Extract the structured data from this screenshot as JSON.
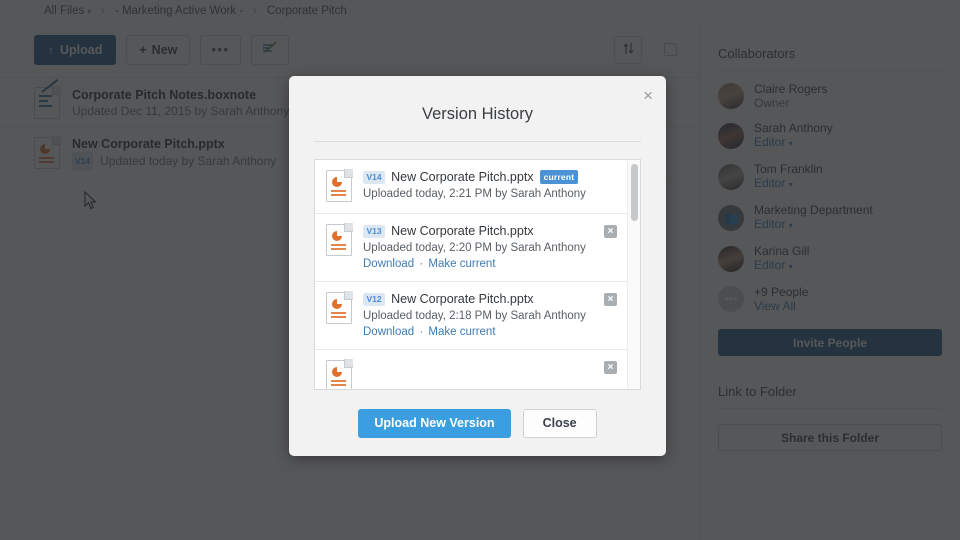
{
  "breadcrumb": {
    "items": [
      {
        "label": "All Files",
        "caret": true
      },
      {
        "label": "- Marketing Active Work -",
        "caret": false
      },
      {
        "label": "Corporate Pitch",
        "caret": false
      }
    ],
    "separator": "›",
    "caret_glyph": "▾"
  },
  "toolbar": {
    "upload_label": "Upload",
    "upload_icon": "↑",
    "new_label": "New",
    "new_icon": "+",
    "more_icon": "•••",
    "compose_icon": "compose-icon",
    "sort_icon": "↑↓",
    "select_all_icon": "checkbox-icon"
  },
  "files": [
    {
      "icon": "boxnote-icon",
      "name": "Corporate Pitch Notes.boxnote",
      "subtitle": "Updated Dec 11, 2015 by Sarah Anthony",
      "version_badge": ""
    },
    {
      "icon": "powerpoint-icon",
      "name": "New Corporate Pitch.pptx",
      "subtitle": "Updated today by Sarah Anthony",
      "version_badge": "V14"
    }
  ],
  "sidebar": {
    "collaborators_title": "Collaborators",
    "collaborators": [
      {
        "name": "Claire Rogers",
        "role": "Owner",
        "role_is_link": false,
        "avatar": "photo-avatar"
      },
      {
        "name": "Sarah Anthony",
        "role": "Editor",
        "role_is_link": true,
        "avatar": "photo-avatar"
      },
      {
        "name": "Tom Franklin",
        "role": "Editor",
        "role_is_link": true,
        "avatar": "photo-avatar"
      },
      {
        "name": "Marketing Department",
        "role": "Editor",
        "role_is_link": true,
        "avatar": "group-avatar"
      },
      {
        "name": "Karina Gill",
        "role": "Editor",
        "role_is_link": true,
        "avatar": "photo-avatar"
      },
      {
        "name": "+9 People",
        "role": "View All",
        "role_is_link": true,
        "avatar": "more-avatar"
      }
    ],
    "role_caret": "▾",
    "invite_label": "Invite People",
    "link_title": "Link to Folder",
    "share_label": "Share this Folder"
  },
  "modal": {
    "title": "Version History",
    "close_icon": "×",
    "versions": [
      {
        "badge": "V14",
        "name": "New Corporate Pitch.pptx",
        "current_label": "current",
        "is_current": true,
        "meta": "Uploaded today, 2:21 PM by Sarah Anthony",
        "download_label": "",
        "make_current_label": "",
        "separator": "",
        "deletable": false
      },
      {
        "badge": "V13",
        "name": "New Corporate Pitch.pptx",
        "current_label": "",
        "is_current": false,
        "meta": "Uploaded today, 2:20 PM by Sarah Anthony",
        "download_label": "Download",
        "make_current_label": "Make current",
        "separator": "·",
        "deletable": true,
        "delete_icon": "×"
      },
      {
        "badge": "V12",
        "name": "New Corporate Pitch.pptx",
        "current_label": "",
        "is_current": false,
        "meta": "Uploaded today, 2:18 PM by Sarah Anthony",
        "download_label": "Download",
        "make_current_label": "Make current",
        "separator": "·",
        "deletable": true,
        "delete_icon": "×"
      }
    ],
    "upload_new_label": "Upload New Version",
    "close_label": "Close"
  },
  "colors": {
    "brand_dark_blue": "#1c5e87",
    "primary_blue": "#3b9ee0",
    "link_blue": "#3f7cb5",
    "badge_blue": "#4a92d4",
    "ppt_orange": "#e0702f",
    "overlay": "rgba(38,40,42,0.78)"
  }
}
